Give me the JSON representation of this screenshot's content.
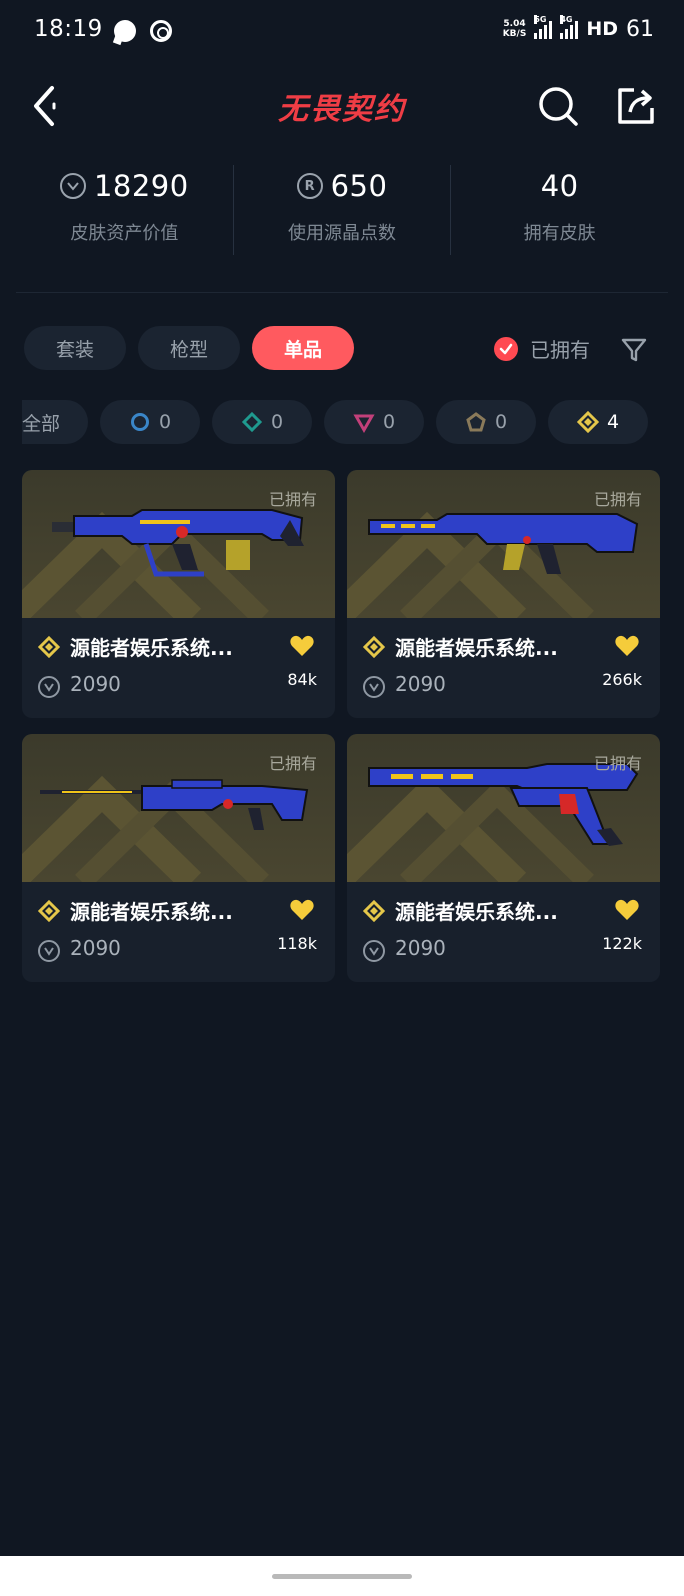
{
  "status_bar": {
    "time": "18:19",
    "speed_top": "5.04",
    "speed_bottom": "KB/S",
    "net1": "5G",
    "net2": "4G",
    "hd": "HD",
    "battery": "61"
  },
  "header": {
    "title": "无畏契约",
    "back_icon": "chevron-left-icon",
    "search_icon": "search-icon",
    "share_icon": "share-icon",
    "accent_color": "#ef3d45"
  },
  "stats": [
    {
      "icon": "V",
      "value": "18290",
      "label": "皮肤资产价值"
    },
    {
      "icon": "R",
      "value": "650",
      "label": "使用源晶点数"
    },
    {
      "icon": "",
      "value": "40",
      "label": "拥有皮肤"
    }
  ],
  "tabs": [
    {
      "label": "套装",
      "active": false
    },
    {
      "label": "枪型",
      "active": false
    },
    {
      "label": "单品",
      "active": true
    }
  ],
  "owned_filter": {
    "label": "已拥有",
    "checked": true
  },
  "tiers": [
    {
      "label": "全部",
      "count": ""
    },
    {
      "icon": "select-tier-icon",
      "count": "0",
      "color": "#3a86c8"
    },
    {
      "icon": "deluxe-tier-icon",
      "count": "0",
      "color": "#1f9a8f"
    },
    {
      "icon": "premium-tier-icon",
      "count": "0",
      "color": "#c2407a"
    },
    {
      "icon": "ultra-tier-icon",
      "count": "0",
      "color": "#8a7a5a"
    },
    {
      "icon": "exclusive-tier-icon",
      "count": "4",
      "color": "#e5c74a"
    }
  ],
  "cards": [
    {
      "owned_tag": "已拥有",
      "name": "源能者娱乐系统...",
      "price": "2090",
      "likes": "84k"
    },
    {
      "owned_tag": "已拥有",
      "name": "源能者娱乐系统...",
      "price": "2090",
      "likes": "266k"
    },
    {
      "owned_tag": "已拥有",
      "name": "源能者娱乐系统...",
      "price": "2090",
      "likes": "118k"
    },
    {
      "owned_tag": "已拥有",
      "name": "源能者娱乐系统...",
      "price": "2090",
      "likes": "122k"
    }
  ]
}
